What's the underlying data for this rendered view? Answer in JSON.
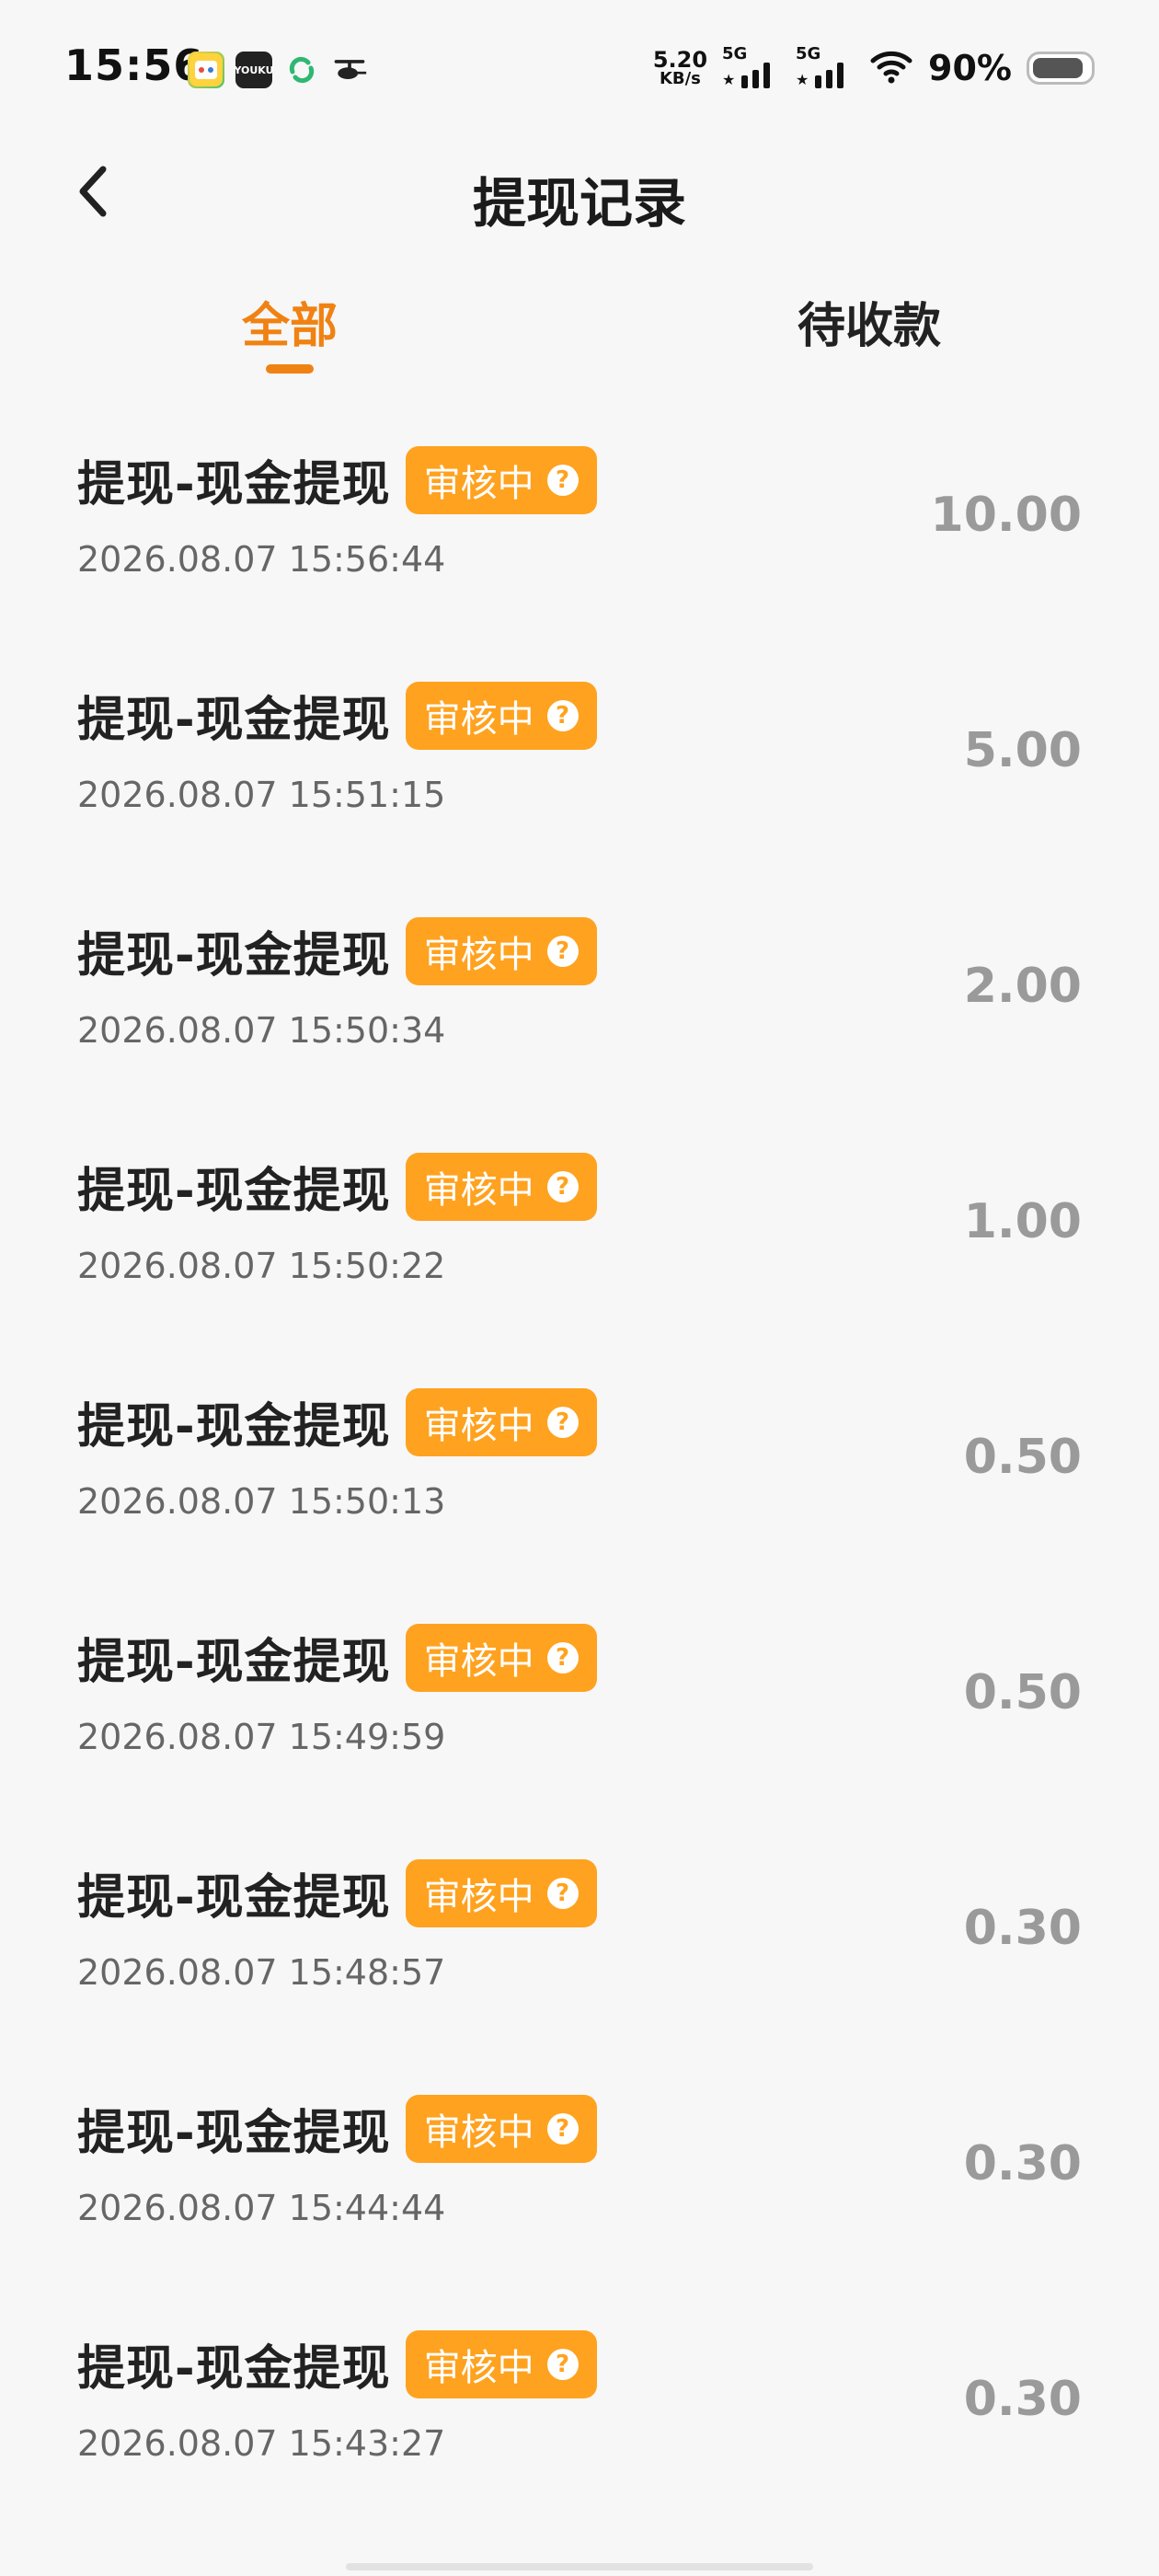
{
  "status_bar": {
    "time": "15:56",
    "apps": [
      "app-game-icon",
      "youku-icon",
      "sync-app-icon",
      "helicopter-app-icon"
    ],
    "app2_text": "YOUKU",
    "net_speed_value": "5.20",
    "net_speed_unit": "KB/s",
    "sim1": "5G",
    "sim2": "5G",
    "battery_percent": "90%"
  },
  "header": {
    "title": "提现记录"
  },
  "tabs": [
    {
      "label": "全部",
      "active": true
    },
    {
      "label": "待收款",
      "active": false
    }
  ],
  "records": [
    {
      "title": "提现-现金提现",
      "status": "审核中",
      "time": "2026.08.07 15:56:44",
      "amount": "10.00"
    },
    {
      "title": "提现-现金提现",
      "status": "审核中",
      "time": "2026.08.07 15:51:15",
      "amount": "5.00"
    },
    {
      "title": "提现-现金提现",
      "status": "审核中",
      "time": "2026.08.07 15:50:34",
      "amount": "2.00"
    },
    {
      "title": "提现-现金提现",
      "status": "审核中",
      "time": "2026.08.07 15:50:22",
      "amount": "1.00"
    },
    {
      "title": "提现-现金提现",
      "status": "审核中",
      "time": "2026.08.07 15:50:13",
      "amount": "0.50"
    },
    {
      "title": "提现-现金提现",
      "status": "审核中",
      "time": "2026.08.07 15:49:59",
      "amount": "0.50"
    },
    {
      "title": "提现-现金提现",
      "status": "审核中",
      "time": "2026.08.07 15:48:57",
      "amount": "0.30"
    },
    {
      "title": "提现-现金提现",
      "status": "审核中",
      "time": "2026.08.07 15:44:44",
      "amount": "0.30"
    },
    {
      "title": "提现-现金提现",
      "status": "审核中",
      "time": "2026.08.07 15:43:27",
      "amount": "0.30"
    }
  ],
  "badge_help_icon": "?",
  "colors": {
    "accent": "#f08213",
    "badge": "#ffa21f",
    "amount": "#9a9a9a",
    "background": "#f7f7f7"
  }
}
